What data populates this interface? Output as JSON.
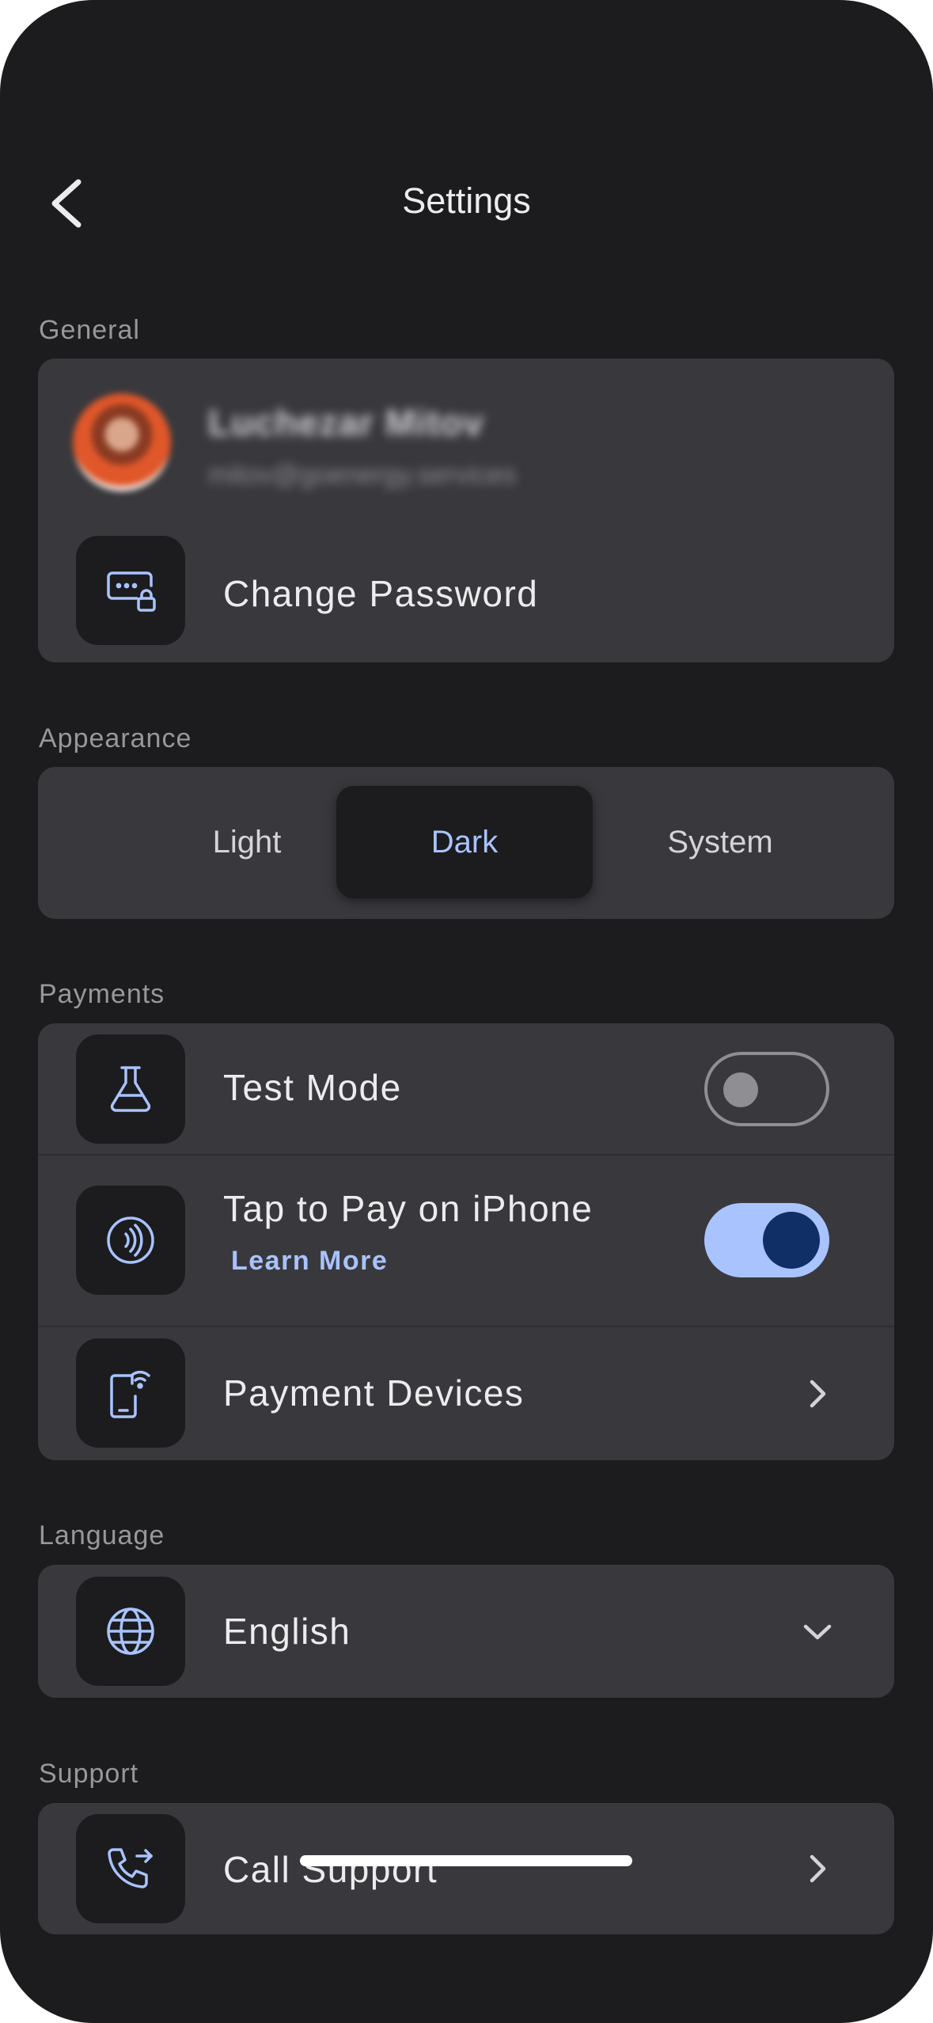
{
  "header": {
    "title": "Settings"
  },
  "sections": {
    "general": "General",
    "appearance": "Appearance",
    "payments": "Payments",
    "language": "Language",
    "support": "Support"
  },
  "profile": {
    "name": "Luchezar Mitov",
    "email": "mitov@goenergy.services"
  },
  "general": {
    "change_password": "Change Password"
  },
  "appearance": {
    "options": [
      "Light",
      "Dark",
      "System"
    ],
    "selected": "Dark"
  },
  "payments": {
    "test_mode": {
      "label": "Test Mode",
      "enabled": false
    },
    "tap_to_pay": {
      "label": "Tap to Pay on iPhone",
      "link": "Learn More",
      "enabled": true
    },
    "payment_devices": {
      "label": "Payment Devices"
    }
  },
  "language": {
    "value": "English"
  },
  "support": {
    "call_support": "Call Support"
  },
  "colors": {
    "background": "#1c1c1e",
    "card": "#39393d",
    "accent": "#a9c3ff",
    "toggle_knob_on": "#0f2f66"
  },
  "icons": {
    "back": "chevron-left-icon",
    "change_password": "password-lock-icon",
    "test_mode": "flask-icon",
    "tap_to_pay": "contactless-icon",
    "payment_devices": "phone-wireless-icon",
    "language": "globe-icon",
    "call_support": "phone-call-icon"
  }
}
